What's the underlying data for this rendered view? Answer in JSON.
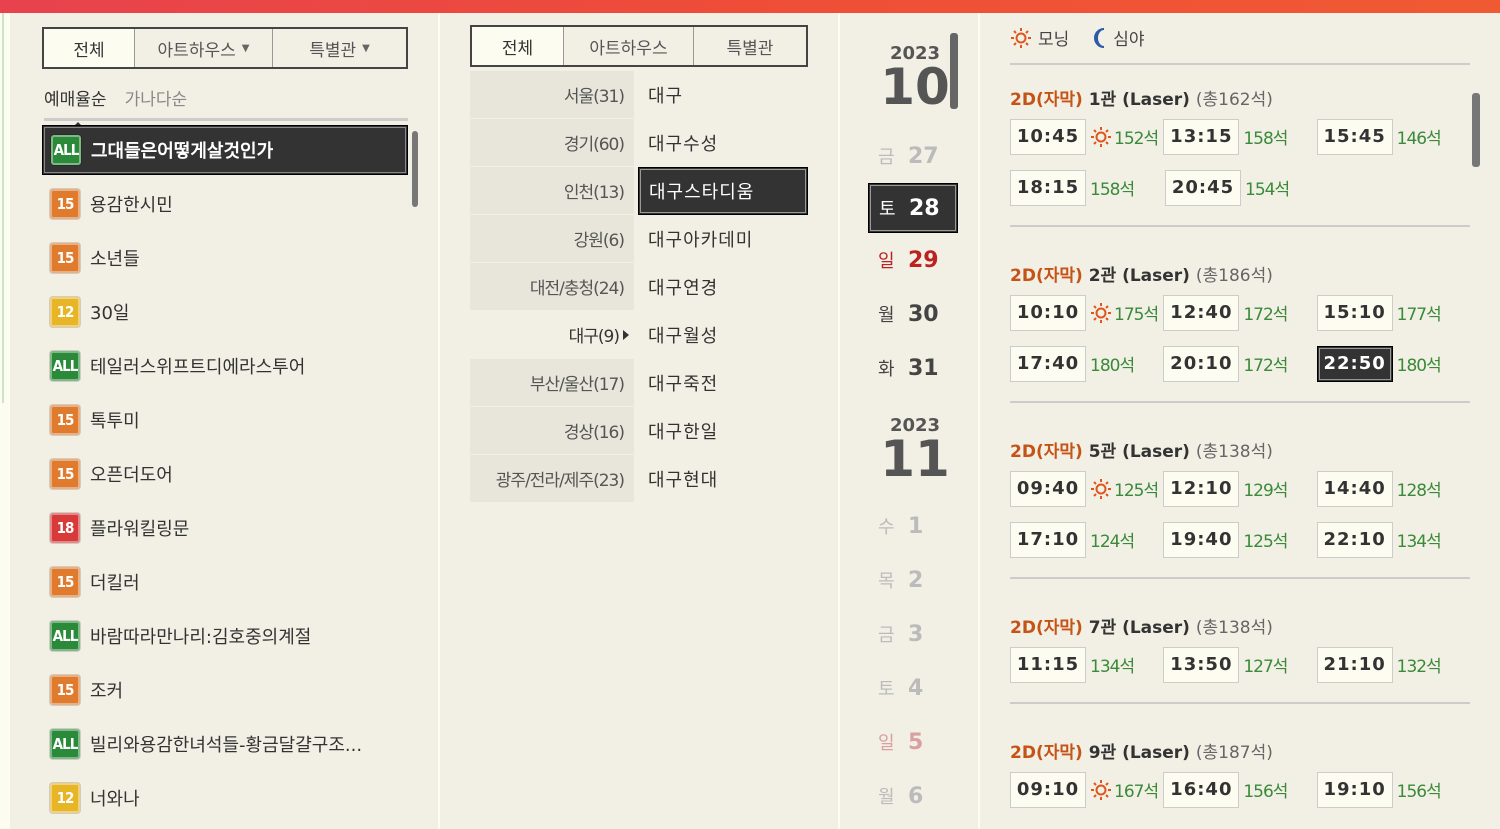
{
  "colors": {
    "accent": "#c55316",
    "seat_green": "#3a8a3a",
    "sunday_red": "#b22222",
    "rating_all": "#2a8a3a",
    "rating_15": "#e07b2e",
    "rating_12": "#e8b526",
    "rating_18": "#d83a3a"
  },
  "movie_panel": {
    "tabs": [
      {
        "label": "전체",
        "dropdown": false
      },
      {
        "label": "아트하우스",
        "dropdown": true
      },
      {
        "label": "특별관",
        "dropdown": true
      }
    ],
    "sort": {
      "by_booking": "예매율순",
      "by_name": "가나다순"
    },
    "movies": [
      {
        "rating": "ALL",
        "rating_color": "#2a8a3a",
        "title": "그대들은어떻게살것인가",
        "selected": true
      },
      {
        "rating": "15",
        "rating_color": "#e07b2e",
        "title": "용감한시민"
      },
      {
        "rating": "15",
        "rating_color": "#e07b2e",
        "title": "소년들"
      },
      {
        "rating": "12",
        "rating_color": "#e8b526",
        "title": "30일"
      },
      {
        "rating": "ALL",
        "rating_color": "#2a8a3a",
        "title": "테일러스위프트디에라스투어"
      },
      {
        "rating": "15",
        "rating_color": "#e07b2e",
        "title": "톡투미"
      },
      {
        "rating": "15",
        "rating_color": "#e07b2e",
        "title": "오픈더도어"
      },
      {
        "rating": "18",
        "rating_color": "#d83a3a",
        "title": "플라워킬링문"
      },
      {
        "rating": "15",
        "rating_color": "#e07b2e",
        "title": "더킬러"
      },
      {
        "rating": "ALL",
        "rating_color": "#2a8a3a",
        "title": "바람따라만나리:김호중의계절"
      },
      {
        "rating": "15",
        "rating_color": "#e07b2e",
        "title": "조커"
      },
      {
        "rating": "ALL",
        "rating_color": "#2a8a3a",
        "title": "빌리와용감한녀석들-황금달걀구조..."
      },
      {
        "rating": "12",
        "rating_color": "#e8b526",
        "title": "너와나"
      }
    ]
  },
  "theater_panel": {
    "tabs": [
      "전체",
      "아트하우스",
      "특별관"
    ],
    "regions": [
      "서울(31)",
      "경기(60)",
      "인천(13)",
      "강원(6)",
      "대전/충청(24)",
      "대구(9)",
      "부산/울산(17)",
      "경상(16)",
      "광주/전라/제주(23)"
    ],
    "selected_region": "대구(9)",
    "theaters": [
      "대구",
      "대구수성",
      "대구스타디움",
      "대구아카데미",
      "대구연경",
      "대구월성",
      "대구죽전",
      "대구한일",
      "대구현대"
    ],
    "selected_theater": "대구스타디움"
  },
  "date_panel": {
    "months": [
      {
        "year": "2023",
        "month": "10"
      },
      {
        "year": "2023",
        "month": "11"
      }
    ],
    "days": [
      {
        "w": "금",
        "d": "27",
        "style": "dim"
      },
      {
        "w": "토",
        "d": "28",
        "style": "sel"
      },
      {
        "w": "일",
        "d": "29",
        "style": "sun"
      },
      {
        "w": "월",
        "d": "30",
        "style": ""
      },
      {
        "w": "화",
        "d": "31",
        "style": ""
      },
      {
        "w": "수",
        "d": "1",
        "style": "dim"
      },
      {
        "w": "목",
        "d": "2",
        "style": "dim"
      },
      {
        "w": "금",
        "d": "3",
        "style": "dim"
      },
      {
        "w": "토",
        "d": "4",
        "style": "dim"
      },
      {
        "w": "일",
        "d": "5",
        "style": "sundim"
      },
      {
        "w": "월",
        "d": "6",
        "style": "dim"
      }
    ]
  },
  "time_panel": {
    "legend": {
      "morning": "모닝",
      "night": "심야",
      "morning_icon": "sun-icon",
      "night_icon": "moon-icon"
    },
    "halls": [
      {
        "format": "2D(자막)",
        "name": "1관 (Laser)",
        "total": "(총162석)",
        "times": [
          {
            "t": "10:45",
            "seats": "152석",
            "morning": true
          },
          {
            "t": "13:15",
            "seats": "158석"
          },
          {
            "t": "15:45",
            "seats": "146석"
          },
          {
            "t": "18:15",
            "seats": "158석"
          },
          {
            "t": "20:45",
            "seats": "154석"
          }
        ]
      },
      {
        "format": "2D(자막)",
        "name": "2관 (Laser)",
        "total": "(총186석)",
        "times": [
          {
            "t": "10:10",
            "seats": "175석",
            "morning": true
          },
          {
            "t": "12:40",
            "seats": "172석"
          },
          {
            "t": "15:10",
            "seats": "177석"
          },
          {
            "t": "17:40",
            "seats": "180석"
          },
          {
            "t": "20:10",
            "seats": "172석"
          },
          {
            "t": "22:50",
            "seats": "180석",
            "selected": true
          }
        ]
      },
      {
        "format": "2D(자막)",
        "name": "5관 (Laser)",
        "total": "(총138석)",
        "times": [
          {
            "t": "09:40",
            "seats": "125석",
            "morning": true
          },
          {
            "t": "12:10",
            "seats": "129석"
          },
          {
            "t": "14:40",
            "seats": "128석"
          },
          {
            "t": "17:10",
            "seats": "124석"
          },
          {
            "t": "19:40",
            "seats": "125석"
          },
          {
            "t": "22:10",
            "seats": "134석"
          }
        ]
      },
      {
        "format": "2D(자막)",
        "name": "7관 (Laser)",
        "total": "(총138석)",
        "times": [
          {
            "t": "11:15",
            "seats": "134석"
          },
          {
            "t": "13:50",
            "seats": "127석"
          },
          {
            "t": "21:10",
            "seats": "132석"
          }
        ]
      },
      {
        "format": "2D(자막)",
        "name": "9관 (Laser)",
        "total": "(총187석)",
        "times": [
          {
            "t": "09:10",
            "seats": "167석",
            "morning": true
          },
          {
            "t": "16:40",
            "seats": "156석"
          },
          {
            "t": "19:10",
            "seats": "156석"
          }
        ]
      }
    ]
  }
}
